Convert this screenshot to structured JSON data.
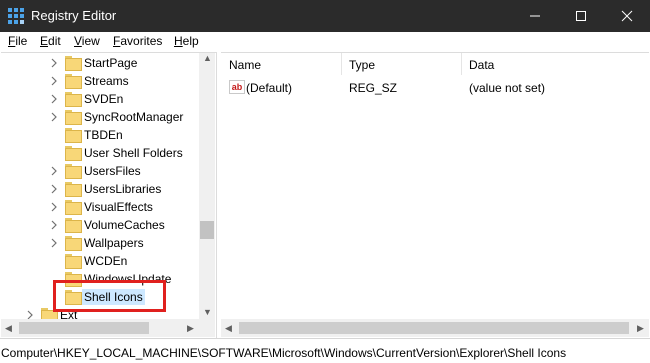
{
  "window": {
    "title": "Registry Editor",
    "icon": "registry-icon",
    "controls": [
      "minimize-icon",
      "maximize-icon",
      "close-icon"
    ]
  },
  "menu": [
    {
      "label": "File",
      "underline": "F",
      "rest": "ile"
    },
    {
      "label": "Edit",
      "underline": "E",
      "rest": "dit"
    },
    {
      "label": "View",
      "underline": "V",
      "rest": "iew"
    },
    {
      "label": "Favorites",
      "underline": "F",
      "rest": "avorites"
    },
    {
      "label": "Help",
      "underline": "H",
      "rest": "elp"
    }
  ],
  "tree": {
    "items": [
      {
        "label": "StartPage",
        "expandable": true
      },
      {
        "label": "Streams",
        "expandable": true
      },
      {
        "label": "SVDEn",
        "expandable": true
      },
      {
        "label": "SyncRootManager",
        "expandable": true
      },
      {
        "label": "TBDEn",
        "expandable": false
      },
      {
        "label": "User Shell Folders",
        "expandable": false
      },
      {
        "label": "UsersFiles",
        "expandable": true
      },
      {
        "label": "UsersLibraries",
        "expandable": true
      },
      {
        "label": "VisualEffects",
        "expandable": true
      },
      {
        "label": "VolumeCaches",
        "expandable": true
      },
      {
        "label": "Wallpapers",
        "expandable": true
      },
      {
        "label": "WCDEn",
        "expandable": false
      },
      {
        "label": "WindowsUpdate",
        "expandable": false
      },
      {
        "label": "Shell Icons",
        "expandable": false,
        "selected": true
      },
      {
        "label": "Ext",
        "expandable": true
      }
    ]
  },
  "list": {
    "columns": [
      "Name",
      "Type",
      "Data"
    ],
    "rows": [
      {
        "icon": "string-value-icon",
        "icon_text": "ab",
        "name": "(Default)",
        "type": "REG_SZ",
        "data": "(value not set)"
      }
    ]
  },
  "status": {
    "path": "Computer\\HKEY_LOCAL_MACHINE\\SOFTWARE\\Microsoft\\Windows\\CurrentVersion\\Explorer\\Shell Icons"
  },
  "colors": {
    "titlebar": "#2b2b2b",
    "selection": "#cde8ff",
    "highlight_box": "#e0201e",
    "folder": "#f8d778"
  }
}
